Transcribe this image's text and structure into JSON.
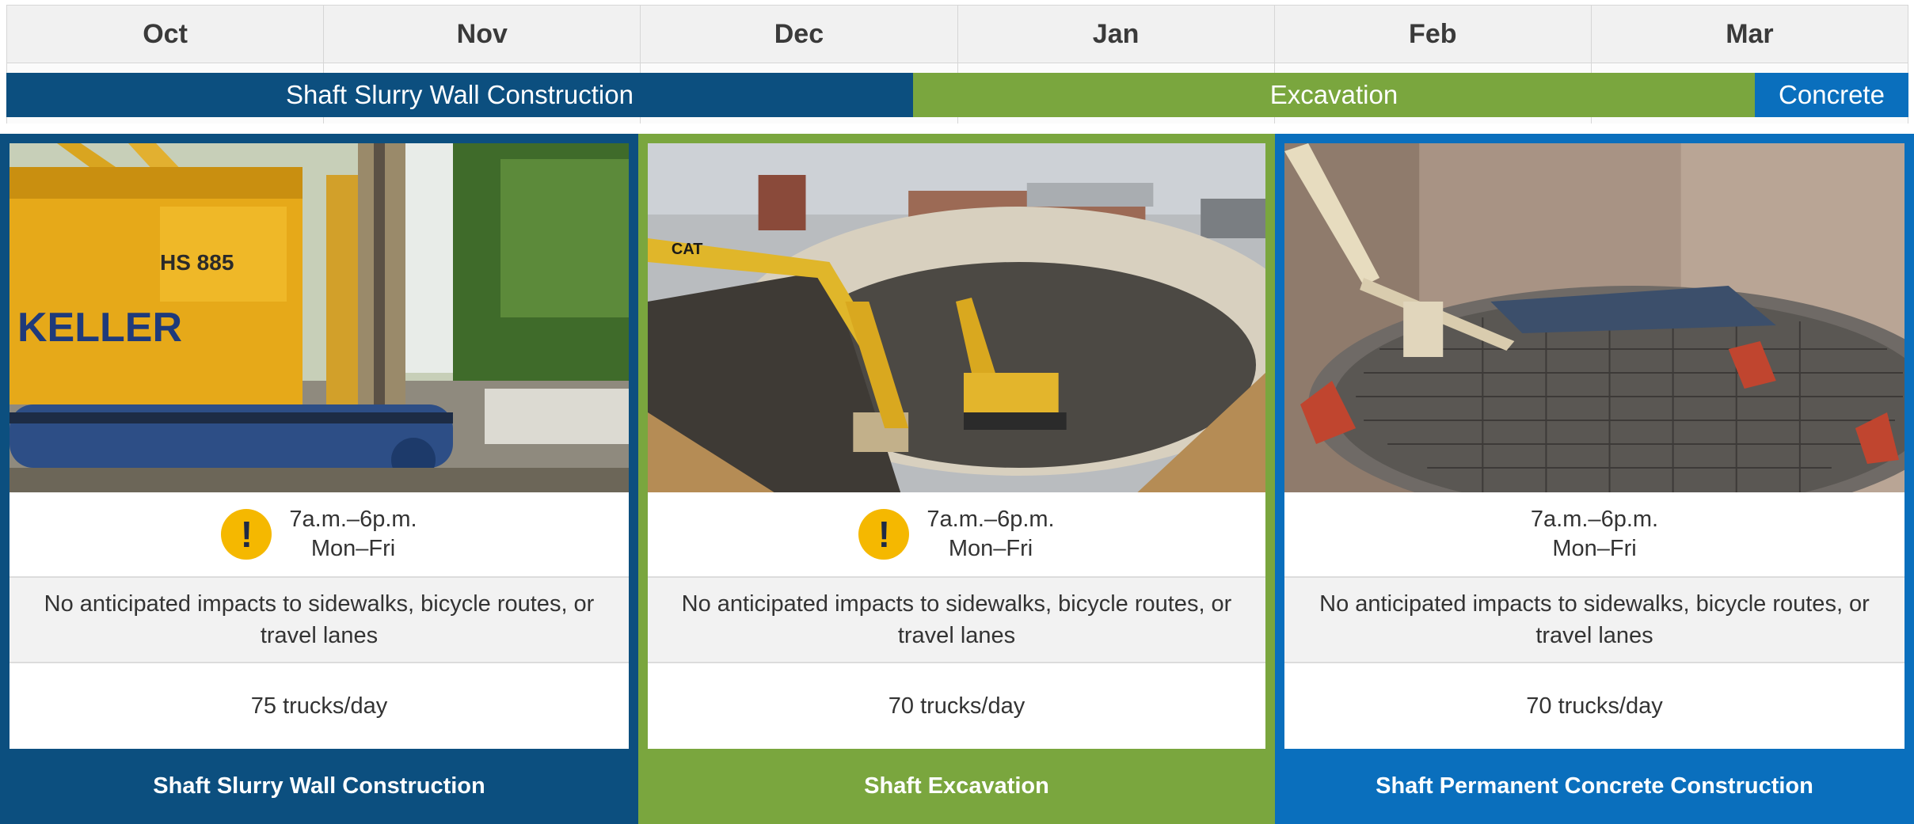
{
  "timeline": {
    "months": [
      "Oct",
      "Nov",
      "Dec",
      "Jan",
      "Feb",
      "Mar"
    ],
    "phases": [
      {
        "label": "Shaft Slurry Wall Construction",
        "color": "#0c4f7f"
      },
      {
        "label": "Excavation",
        "color": "#7aa63e"
      },
      {
        "label": "Concrete",
        "color": "#0a6fbd"
      }
    ]
  },
  "cards": [
    {
      "title": "Shaft Slurry Wall Construction",
      "hours_line1": "7a.m.–6p.m.",
      "hours_line2": "Mon–Fri",
      "warning_icon": "!",
      "impact": "No anticipated impacts to sidewalks, bicycle routes, or travel lanes",
      "trucks": "75 trucks/day",
      "photo_text": "KELLER",
      "photo_model": "HS 885"
    },
    {
      "title": "Shaft Excavation",
      "hours_line1": "7a.m.–6p.m.",
      "hours_line2": "Mon–Fri",
      "warning_icon": "!",
      "impact": "No anticipated impacts to sidewalks, bicycle routes, or travel lanes",
      "trucks": "70 trucks/day",
      "photo_text": "CAT"
    },
    {
      "title": "Shaft Permanent Concrete Construction",
      "hours_line1": "7a.m.–6p.m.",
      "hours_line2": "Mon–Fri",
      "impact": "No anticipated impacts to sidewalks, bicycle routes, or travel lanes",
      "trucks": "70 trucks/day"
    }
  ]
}
